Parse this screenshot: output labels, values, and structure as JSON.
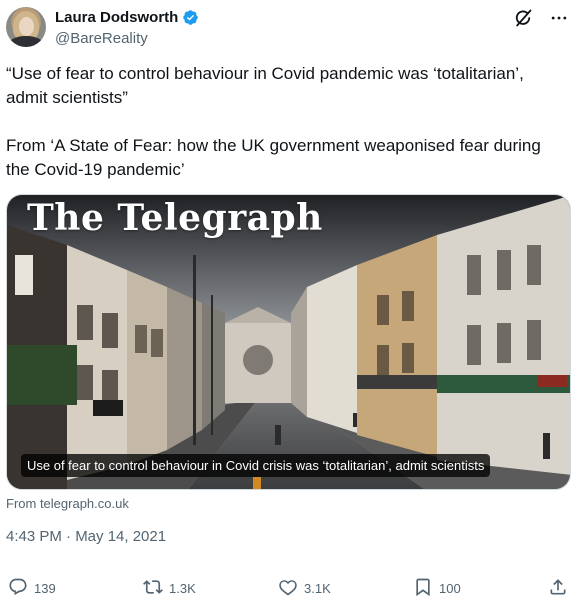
{
  "author": {
    "display_name": "Laura Dodsworth",
    "handle": "@BareReality"
  },
  "tweet": {
    "paragraph_1": "“Use of fear to control behaviour in Covid pandemic was ‘totalitarian’, admit scientists”",
    "paragraph_2": "From ‘A State of Fear: how the UK government weaponised fear during the Covid-19 pandemic’"
  },
  "link_card": {
    "masthead": "The Telegraph",
    "caption": "Use of fear to control behaviour in Covid crisis was ‘totalitarian’, admit scientists",
    "source": "From telegraph.co.uk"
  },
  "timestamp": "4:43 PM · May 14, 2021",
  "actions": {
    "replies": "139",
    "retweets": "1.3K",
    "likes": "3.1K",
    "bookmarks": "100"
  },
  "icons": [
    "verified-badge-icon",
    "grok-icon",
    "more-icon",
    "reply-icon",
    "retweet-icon",
    "like-icon",
    "bookmark-icon",
    "share-icon"
  ],
  "colors": {
    "verified": "#1d9bf0",
    "secondary_text": "#536471",
    "primary_text": "#0f1419"
  }
}
